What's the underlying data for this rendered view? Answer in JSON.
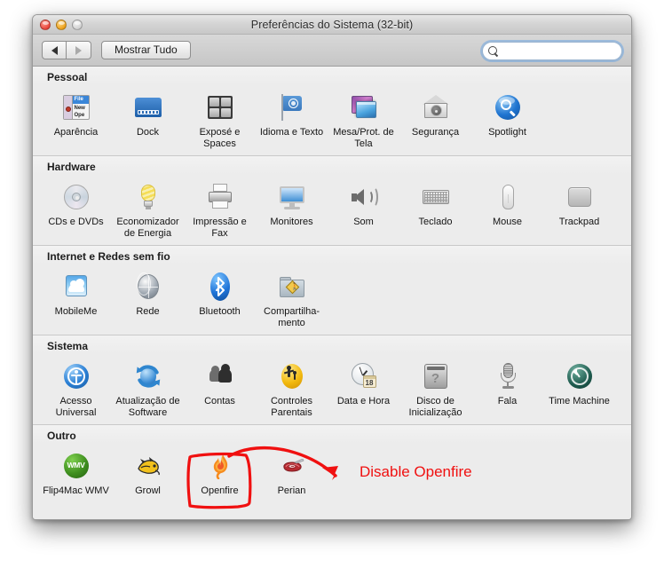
{
  "window": {
    "title": "Preferências do Sistema (32-bit)",
    "traffic_lights": [
      "close",
      "minimize",
      "zoom"
    ]
  },
  "toolbar": {
    "back_label": "back-arrow",
    "forward_label": "forward-arrow",
    "show_all_label": "Mostrar Tudo",
    "search_value": "",
    "search_placeholder": ""
  },
  "sections": [
    {
      "title": "Pessoal",
      "items": [
        {
          "label": "Aparência",
          "icon": "appearance-icon"
        },
        {
          "label": "Dock",
          "icon": "dock-icon"
        },
        {
          "label": "Exposé e Spaces",
          "icon": "expose-spaces-icon"
        },
        {
          "label": "Idioma e Texto",
          "icon": "language-text-icon"
        },
        {
          "label": "Mesa/Prot. de Tela",
          "icon": "desktop-screensaver-icon"
        },
        {
          "label": "Segurança",
          "icon": "security-icon"
        },
        {
          "label": "Spotlight",
          "icon": "spotlight-icon"
        }
      ]
    },
    {
      "title": "Hardware",
      "items": [
        {
          "label": "CDs e DVDs",
          "icon": "cds-dvds-icon"
        },
        {
          "label": "Economizador de Energia",
          "icon": "energy-saver-icon"
        },
        {
          "label": "Impressão e Fax",
          "icon": "print-fax-icon"
        },
        {
          "label": "Monitores",
          "icon": "displays-icon"
        },
        {
          "label": "Som",
          "icon": "sound-icon"
        },
        {
          "label": "Teclado",
          "icon": "keyboard-icon"
        },
        {
          "label": "Mouse",
          "icon": "mouse-icon"
        },
        {
          "label": "Trackpad",
          "icon": "trackpad-icon"
        }
      ]
    },
    {
      "title": "Internet e Redes sem fio",
      "items": [
        {
          "label": "MobileMe",
          "icon": "mobileme-icon"
        },
        {
          "label": "Rede",
          "icon": "network-icon"
        },
        {
          "label": "Bluetooth",
          "icon": "bluetooth-icon"
        },
        {
          "label": "Compartilha-mento",
          "icon": "sharing-icon"
        }
      ]
    },
    {
      "title": "Sistema",
      "items": [
        {
          "label": "Acesso Universal",
          "icon": "universal-access-icon"
        },
        {
          "label": "Atualização de Software",
          "icon": "software-update-icon"
        },
        {
          "label": "Contas",
          "icon": "accounts-icon"
        },
        {
          "label": "Controles Parentais",
          "icon": "parental-controls-icon"
        },
        {
          "label": "Data e Hora",
          "icon": "date-time-icon",
          "calendar_day": "18"
        },
        {
          "label": "Disco de Inicialização",
          "icon": "startup-disk-icon"
        },
        {
          "label": "Fala",
          "icon": "speech-icon"
        },
        {
          "label": "Time Machine",
          "icon": "time-machine-icon"
        }
      ]
    },
    {
      "title": "Outro",
      "items": [
        {
          "label": "Flip4Mac WMV",
          "icon": "flip4mac-wmv-icon",
          "badge": "WMV"
        },
        {
          "label": "Growl",
          "icon": "growl-icon"
        },
        {
          "label": "Openfire",
          "icon": "openfire-icon"
        },
        {
          "label": "Perian",
          "icon": "perian-icon"
        }
      ]
    }
  ],
  "annotation": {
    "text": "Disable Openfire",
    "color": "#f01010",
    "highlight_target": "Openfire"
  }
}
